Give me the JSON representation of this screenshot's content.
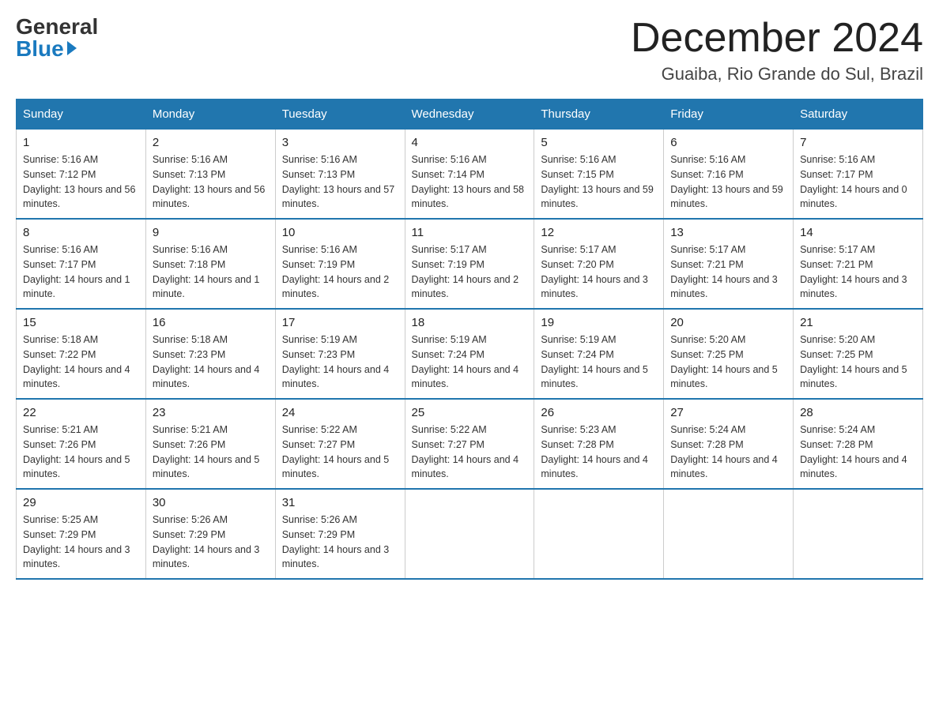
{
  "header": {
    "logo_general": "General",
    "logo_blue": "Blue",
    "month_title": "December 2024",
    "location": "Guaiba, Rio Grande do Sul, Brazil"
  },
  "days_of_week": [
    "Sunday",
    "Monday",
    "Tuesday",
    "Wednesday",
    "Thursday",
    "Friday",
    "Saturday"
  ],
  "weeks": [
    [
      {
        "day": "1",
        "sunrise": "5:16 AM",
        "sunset": "7:12 PM",
        "daylight": "13 hours and 56 minutes."
      },
      {
        "day": "2",
        "sunrise": "5:16 AM",
        "sunset": "7:13 PM",
        "daylight": "13 hours and 56 minutes."
      },
      {
        "day": "3",
        "sunrise": "5:16 AM",
        "sunset": "7:13 PM",
        "daylight": "13 hours and 57 minutes."
      },
      {
        "day": "4",
        "sunrise": "5:16 AM",
        "sunset": "7:14 PM",
        "daylight": "13 hours and 58 minutes."
      },
      {
        "day": "5",
        "sunrise": "5:16 AM",
        "sunset": "7:15 PM",
        "daylight": "13 hours and 59 minutes."
      },
      {
        "day": "6",
        "sunrise": "5:16 AM",
        "sunset": "7:16 PM",
        "daylight": "13 hours and 59 minutes."
      },
      {
        "day": "7",
        "sunrise": "5:16 AM",
        "sunset": "7:17 PM",
        "daylight": "14 hours and 0 minutes."
      }
    ],
    [
      {
        "day": "8",
        "sunrise": "5:16 AM",
        "sunset": "7:17 PM",
        "daylight": "14 hours and 1 minute."
      },
      {
        "day": "9",
        "sunrise": "5:16 AM",
        "sunset": "7:18 PM",
        "daylight": "14 hours and 1 minute."
      },
      {
        "day": "10",
        "sunrise": "5:16 AM",
        "sunset": "7:19 PM",
        "daylight": "14 hours and 2 minutes."
      },
      {
        "day": "11",
        "sunrise": "5:17 AM",
        "sunset": "7:19 PM",
        "daylight": "14 hours and 2 minutes."
      },
      {
        "day": "12",
        "sunrise": "5:17 AM",
        "sunset": "7:20 PM",
        "daylight": "14 hours and 3 minutes."
      },
      {
        "day": "13",
        "sunrise": "5:17 AM",
        "sunset": "7:21 PM",
        "daylight": "14 hours and 3 minutes."
      },
      {
        "day": "14",
        "sunrise": "5:17 AM",
        "sunset": "7:21 PM",
        "daylight": "14 hours and 3 minutes."
      }
    ],
    [
      {
        "day": "15",
        "sunrise": "5:18 AM",
        "sunset": "7:22 PM",
        "daylight": "14 hours and 4 minutes."
      },
      {
        "day": "16",
        "sunrise": "5:18 AM",
        "sunset": "7:23 PM",
        "daylight": "14 hours and 4 minutes."
      },
      {
        "day": "17",
        "sunrise": "5:19 AM",
        "sunset": "7:23 PM",
        "daylight": "14 hours and 4 minutes."
      },
      {
        "day": "18",
        "sunrise": "5:19 AM",
        "sunset": "7:24 PM",
        "daylight": "14 hours and 4 minutes."
      },
      {
        "day": "19",
        "sunrise": "5:19 AM",
        "sunset": "7:24 PM",
        "daylight": "14 hours and 5 minutes."
      },
      {
        "day": "20",
        "sunrise": "5:20 AM",
        "sunset": "7:25 PM",
        "daylight": "14 hours and 5 minutes."
      },
      {
        "day": "21",
        "sunrise": "5:20 AM",
        "sunset": "7:25 PM",
        "daylight": "14 hours and 5 minutes."
      }
    ],
    [
      {
        "day": "22",
        "sunrise": "5:21 AM",
        "sunset": "7:26 PM",
        "daylight": "14 hours and 5 minutes."
      },
      {
        "day": "23",
        "sunrise": "5:21 AM",
        "sunset": "7:26 PM",
        "daylight": "14 hours and 5 minutes."
      },
      {
        "day": "24",
        "sunrise": "5:22 AM",
        "sunset": "7:27 PM",
        "daylight": "14 hours and 5 minutes."
      },
      {
        "day": "25",
        "sunrise": "5:22 AM",
        "sunset": "7:27 PM",
        "daylight": "14 hours and 4 minutes."
      },
      {
        "day": "26",
        "sunrise": "5:23 AM",
        "sunset": "7:28 PM",
        "daylight": "14 hours and 4 minutes."
      },
      {
        "day": "27",
        "sunrise": "5:24 AM",
        "sunset": "7:28 PM",
        "daylight": "14 hours and 4 minutes."
      },
      {
        "day": "28",
        "sunrise": "5:24 AM",
        "sunset": "7:28 PM",
        "daylight": "14 hours and 4 minutes."
      }
    ],
    [
      {
        "day": "29",
        "sunrise": "5:25 AM",
        "sunset": "7:29 PM",
        "daylight": "14 hours and 3 minutes."
      },
      {
        "day": "30",
        "sunrise": "5:26 AM",
        "sunset": "7:29 PM",
        "daylight": "14 hours and 3 minutes."
      },
      {
        "day": "31",
        "sunrise": "5:26 AM",
        "sunset": "7:29 PM",
        "daylight": "14 hours and 3 minutes."
      },
      null,
      null,
      null,
      null
    ]
  ],
  "labels": {
    "sunrise": "Sunrise:",
    "sunset": "Sunset:",
    "daylight": "Daylight:"
  }
}
